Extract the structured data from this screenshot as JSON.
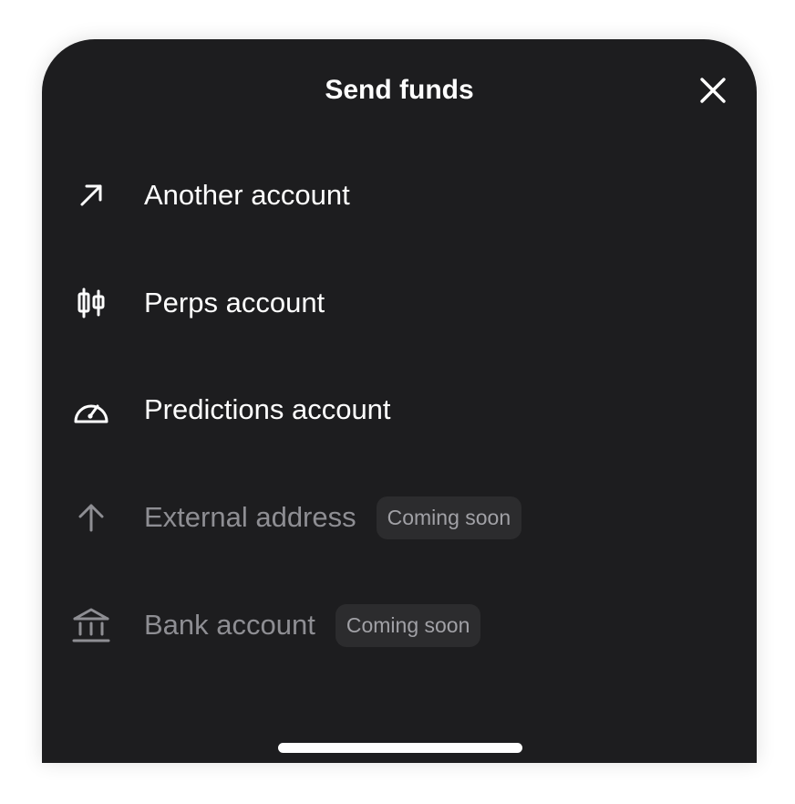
{
  "sheet": {
    "title": "Send funds",
    "close_icon": "close-icon"
  },
  "items": [
    {
      "label": "Another account",
      "icon": "arrow-up-right-icon",
      "enabled": true
    },
    {
      "label": "Perps account",
      "icon": "candlestick-icon",
      "enabled": true
    },
    {
      "label": "Predictions account",
      "icon": "gauge-icon",
      "enabled": true
    },
    {
      "label": "External address",
      "icon": "arrow-up-icon",
      "enabled": false,
      "badge": "Coming soon"
    },
    {
      "label": "Bank account",
      "icon": "bank-icon",
      "enabled": false,
      "badge": "Coming soon"
    }
  ],
  "colors": {
    "sheet_background": "#1d1d1f",
    "text_primary": "#ffffff",
    "text_disabled": "#8e8e93",
    "badge_background": "#2c2c2e",
    "badge_text": "#a1a1a6"
  }
}
